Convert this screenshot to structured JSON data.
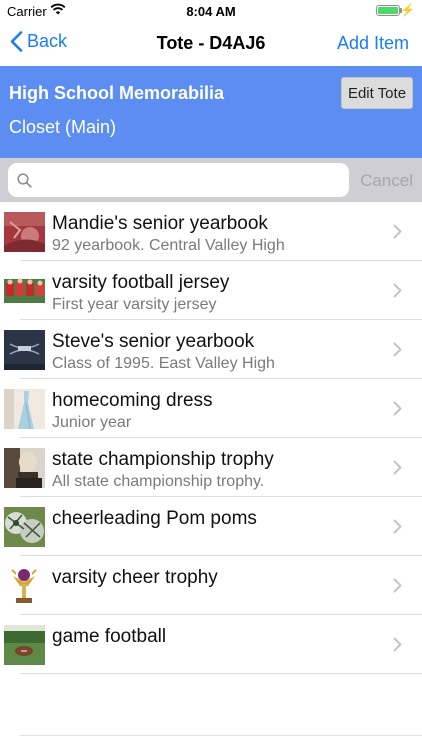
{
  "status_bar": {
    "carrier": "Carrier",
    "time": "8:04 AM",
    "battery_level": 1.0
  },
  "nav": {
    "back_label": "Back",
    "title": "Tote - D4AJ6",
    "add_label": "Add Item"
  },
  "tote": {
    "name": "High School Memorabilia",
    "location": "Closet (Main)",
    "edit_label": "Edit Tote"
  },
  "search": {
    "placeholder": "",
    "cancel_label": "Cancel"
  },
  "colors": {
    "accent": "#1a7cf5",
    "header_bg": "#5b8ef0",
    "search_bg": "#cfcfd3"
  },
  "items": [
    {
      "title": "Mandie's senior yearbook",
      "subtitle": "92 yearbook. Central Valley High",
      "thumb_icon": "red-yearbook-photo"
    },
    {
      "title": "varsity football jersey",
      "subtitle": "First year varsity jersey",
      "thumb_icon": "football-team-photo"
    },
    {
      "title": "Steve's senior yearbook",
      "subtitle": "Class of 1995. East Valley High",
      "thumb_icon": "navy-yearbook-photo"
    },
    {
      "title": "homecoming dress",
      "subtitle": "Junior year",
      "thumb_icon": "blue-dress-photo"
    },
    {
      "title": "state championship trophy",
      "subtitle": "All state championship trophy.",
      "thumb_icon": "trophy-photo"
    },
    {
      "title": "cheerleading Pom poms",
      "subtitle": "",
      "thumb_icon": "pom-poms-photo"
    },
    {
      "title": "varsity cheer trophy",
      "subtitle": "",
      "thumb_icon": "cheer-trophy-photo"
    },
    {
      "title": "game football",
      "subtitle": "",
      "thumb_icon": "football-on-grass-photo"
    }
  ]
}
